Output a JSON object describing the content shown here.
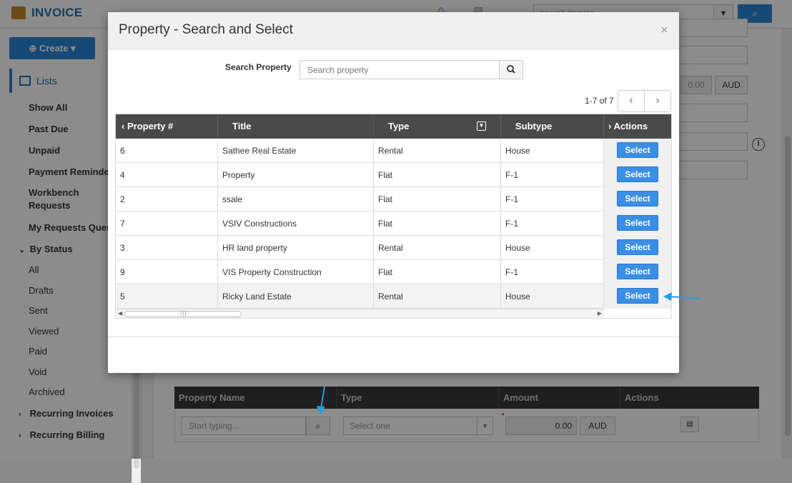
{
  "app": {
    "title": "INVOICE",
    "top_search_placeholder": "search invoice",
    "create_label": "Create",
    "lists_label": "Lists"
  },
  "sidebar": {
    "items": [
      {
        "label": "Show All"
      },
      {
        "label": "Past Due"
      },
      {
        "label": "Unpaid"
      },
      {
        "label": "Payment Reminders"
      },
      {
        "label": "Workbench Requests"
      },
      {
        "label": "My Requests Queue"
      }
    ],
    "status_group": "By Status",
    "status_items": [
      "All",
      "Drafts",
      "Sent",
      "Viewed",
      "Paid",
      "Void",
      "Archived"
    ],
    "recurring_invoices": "Recurring Invoices",
    "recurring_billing": "Recurring Billing"
  },
  "background": {
    "amount": "0.00",
    "currency": "AUD"
  },
  "bottom_table": {
    "headers": [
      "Property Name",
      "Type",
      "Amount",
      "Actions"
    ],
    "property_placeholder": "Start typing...",
    "type_placeholder": "Select one",
    "amount": "0.00",
    "currency": "AUD"
  },
  "modal": {
    "title": "Property - Search and Select",
    "close": "×",
    "search_label": "Search Property",
    "search_placeholder": "Search property",
    "pager": "1-7 of 7",
    "columns": {
      "number": "Property #",
      "title": "Title",
      "type": "Type",
      "subtype": "Subtype",
      "actions": "Actions"
    },
    "select_label": "Select",
    "rows": [
      {
        "number": "6",
        "title": "Sathee Real Estate",
        "type": "Rental",
        "subtype": "House"
      },
      {
        "number": "4",
        "title": "Property",
        "type": "Flat",
        "subtype": "F-1"
      },
      {
        "number": "2",
        "title": "ssale",
        "type": "Flat",
        "subtype": "F-1"
      },
      {
        "number": "7",
        "title": "VSIV Constructions",
        "type": "Flat",
        "subtype": "F-1"
      },
      {
        "number": "3",
        "title": "HR land property",
        "type": "Rental",
        "subtype": "House"
      },
      {
        "number": "9",
        "title": "VIS Property Construction",
        "type": "Flat",
        "subtype": "F-1"
      },
      {
        "number": "5",
        "title": "Ricky Land Estate",
        "type": "Rental",
        "subtype": "House"
      }
    ]
  },
  "colors": {
    "accent": "#2a85d8",
    "select_button": "#3a8ee6",
    "grid_header": "#4a4a4a",
    "annotation_arrow": "#1ea0e0"
  }
}
